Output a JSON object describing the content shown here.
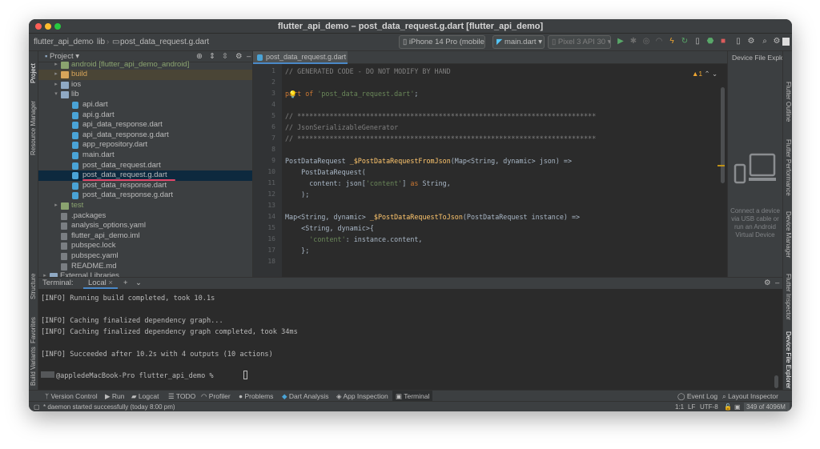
{
  "window": {
    "title": "flutter_api_demo – post_data_request.g.dart [flutter_api_demo]"
  },
  "toolbar": {
    "crumb_project": "flutter_api_demo",
    "crumb_folder": "lib",
    "crumb_file": "post_data_request.g.dart",
    "device_selector": "iPhone 14 Pro (mobile)",
    "run_config": "main.dart",
    "emulator": "Pixel 3 API 30"
  },
  "left_strip": {
    "project": "Project",
    "resource_manager": "Resource Manager",
    "structure": "Structure",
    "favorites": "Favorites",
    "build_variants": "Build Variants"
  },
  "project_panel": {
    "header": "Project",
    "tree": [
      {
        "label": "android [flutter_api_demo_android]",
        "indent": 2,
        "arrow": "▸",
        "kind": "folder-green"
      },
      {
        "label": "build",
        "indent": 2,
        "arrow": "▸",
        "kind": "folder-orange",
        "build": true
      },
      {
        "label": "ios",
        "indent": 2,
        "arrow": "▸",
        "kind": "folder"
      },
      {
        "label": "lib",
        "indent": 2,
        "arrow": "▾",
        "kind": "folder"
      },
      {
        "label": "api.dart",
        "indent": 4,
        "kind": "dart"
      },
      {
        "label": "api.g.dart",
        "indent": 4,
        "kind": "dart"
      },
      {
        "label": "api_data_response.dart",
        "indent": 4,
        "kind": "dart"
      },
      {
        "label": "api_data_response.g.dart",
        "indent": 4,
        "kind": "dart"
      },
      {
        "label": "app_repository.dart",
        "indent": 4,
        "kind": "dart"
      },
      {
        "label": "main.dart",
        "indent": 4,
        "kind": "dart"
      },
      {
        "label": "post_data_request.dart",
        "indent": 4,
        "kind": "dart"
      },
      {
        "label": "post_data_request.g.dart",
        "indent": 4,
        "kind": "dart",
        "selected": true
      },
      {
        "label": "post_data_response.dart",
        "indent": 4,
        "kind": "dart"
      },
      {
        "label": "post_data_response.g.dart",
        "indent": 4,
        "kind": "dart"
      },
      {
        "label": "test",
        "indent": 2,
        "arrow": "▸",
        "kind": "folder-green"
      },
      {
        "label": ".packages",
        "indent": 2,
        "kind": "file"
      },
      {
        "label": "analysis_options.yaml",
        "indent": 2,
        "kind": "file"
      },
      {
        "label": "flutter_api_demo.iml",
        "indent": 2,
        "kind": "file"
      },
      {
        "label": "pubspec.lock",
        "indent": 2,
        "kind": "file"
      },
      {
        "label": "pubspec.yaml",
        "indent": 2,
        "kind": "file"
      },
      {
        "label": "README.md",
        "indent": 2,
        "kind": "file"
      },
      {
        "label": "External Libraries",
        "indent": 0,
        "arrow": "▸",
        "kind": "lib"
      }
    ]
  },
  "editor": {
    "tab": "post_data_request.g.dart",
    "warnings": "▲1",
    "lines": [
      {
        "n": "1",
        "html": "<span class=\"c-com\">// GENERATED CODE - DO NOT MODIFY BY HAND</span>"
      },
      {
        "n": "2",
        "html": ""
      },
      {
        "n": "3",
        "html": "<span class=\"c-kw\">part of </span><span class=\"c-str\">'post_data_request.dart'</span>;"
      },
      {
        "n": "4",
        "html": ""
      },
      {
        "n": "5",
        "html": "<span class=\"c-com\">// **************************************************************************</span>"
      },
      {
        "n": "6",
        "html": "<span class=\"c-com\">// JsonSerializableGenerator</span>"
      },
      {
        "n": "7",
        "html": "<span class=\"c-com\">// **************************************************************************</span>"
      },
      {
        "n": "8",
        "html": ""
      },
      {
        "n": "9",
        "html": "PostDataRequest <span class=\"c-fn\">_$PostDataRequestFromJson</span>(Map&lt;String, dynamic&gt; json) =&gt;"
      },
      {
        "n": "10",
        "html": "    PostDataRequest("
      },
      {
        "n": "11",
        "html": "      content: json[<span class=\"c-str\">'content'</span>] <span class=\"c-kw\">as</span> String,"
      },
      {
        "n": "12",
        "html": "    );"
      },
      {
        "n": "13",
        "html": ""
      },
      {
        "n": "14",
        "html": "Map&lt;String, dynamic&gt; <span class=\"c-fn\">_$PostDataRequestToJson</span>(PostDataRequest instance) =&gt;"
      },
      {
        "n": "15",
        "html": "    &lt;String, dynamic&gt;{"
      },
      {
        "n": "16",
        "html": "      <span class=\"c-str\">'content'</span>: instance.content,"
      },
      {
        "n": "17",
        "html": "    };"
      },
      {
        "n": "18",
        "html": ""
      }
    ]
  },
  "device_file_explorer": {
    "title": "Device File Explo",
    "message": "Connect a device via USB cable or run an Android Virtual Device"
  },
  "right_strip": {
    "outline": "Flutter Outline",
    "performance": "Flutter Performance",
    "device_manager": "Device Manager",
    "inspector": "Flutter Inspector",
    "dfe": "Device File Explorer"
  },
  "terminal": {
    "label": "Terminal:",
    "tab": "Local",
    "lines": [
      "[INFO] Running build completed, took 10.1s",
      "",
      "[INFO] Caching finalized dependency graph...",
      "[INFO] Caching finalized dependency graph completed, took 34ms",
      "",
      "[INFO] Succeeded after 10.2s with 4 outputs (10 actions)",
      "",
      "@appledeMacBook-Pro flutter_api_demo % "
    ]
  },
  "bottom_tools": {
    "version_control": "Version Control",
    "run": "Run",
    "logcat": "Logcat",
    "todo": "TODO",
    "profiler": "Profiler",
    "problems": "Problems",
    "dart_analysis": "Dart Analysis",
    "app_inspection": "App Inspection",
    "terminal": "Terminal",
    "event_log": "Event Log",
    "layout_inspector": "Layout Inspector"
  },
  "status": {
    "message": "* daemon started successfully (today 8:00 pm)",
    "position": "1:1",
    "line_sep": "LF",
    "encoding": "UTF-8",
    "memory": "349 of 4096M"
  }
}
